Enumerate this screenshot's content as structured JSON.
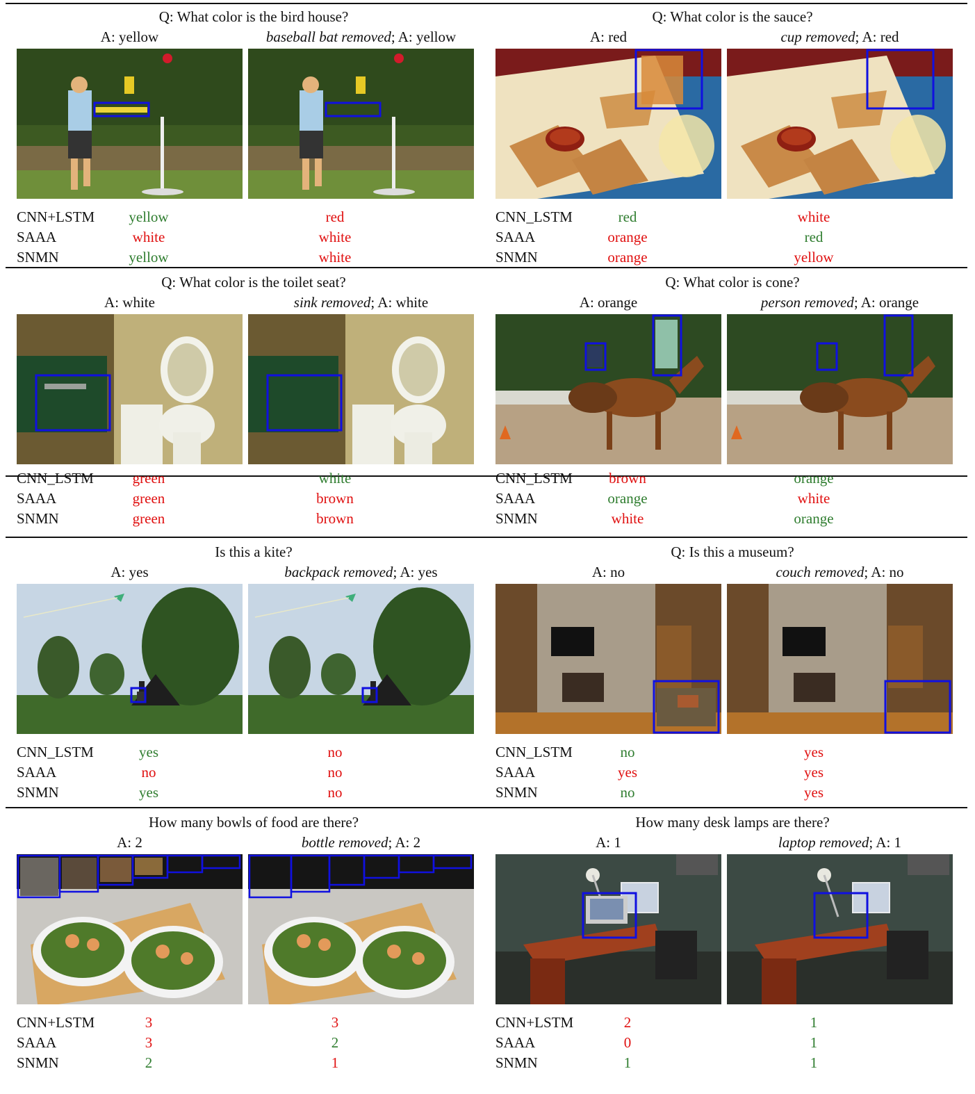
{
  "colors": {
    "correct": "#2f7d2f",
    "wrong": "#e01010",
    "box": "#1010e0"
  },
  "rows": [
    {
      "panels": [
        {
          "question": "Q: What color is the bird house?",
          "answer_orig": "A: yellow",
          "removed_object": "baseball bat removed",
          "answer_edit": "; A: yellow",
          "image_orig_icon": "photo-boy-batting",
          "image_edit_icon": "photo-boy-batting-bat-removed",
          "results": [
            {
              "model": "CNN+LSTM",
              "orig": "yellow",
              "orig_status": "correct",
              "edit": "red",
              "edit_status": "wrong"
            },
            {
              "model": "SAAA",
              "orig": "white",
              "orig_status": "wrong",
              "edit": "white",
              "edit_status": "wrong"
            },
            {
              "model": "SNMN",
              "orig": "yellow",
              "orig_status": "correct",
              "edit": "white",
              "edit_status": "wrong"
            }
          ]
        },
        {
          "question": "Q: What color is the sauce?",
          "answer_orig": "A: red",
          "removed_object": "cup removed",
          "answer_edit": "; A: red",
          "image_orig_icon": "photo-samosas",
          "image_edit_icon": "photo-samosas-cup-removed",
          "results": [
            {
              "model": "CNN_LSTM",
              "orig": "red",
              "orig_status": "correct",
              "edit": "white",
              "edit_status": "wrong"
            },
            {
              "model": "SAAA",
              "orig": "orange",
              "orig_status": "wrong",
              "edit": "red",
              "edit_status": "correct"
            },
            {
              "model": "SNMN",
              "orig": "orange",
              "orig_status": "wrong",
              "edit": "yellow",
              "edit_status": "wrong"
            }
          ]
        }
      ]
    },
    {
      "panels": [
        {
          "question": "Q: What color is the toilet seat?",
          "answer_orig": "A: white",
          "removed_object": "sink removed",
          "answer_edit": "; A: white",
          "image_orig_icon": "photo-bathroom",
          "image_edit_icon": "photo-bathroom-sink-removed",
          "results": [
            {
              "model": "CNN_LSTM",
              "orig": "green",
              "orig_status": "wrong",
              "edit": "white",
              "edit_status": "correct"
            },
            {
              "model": "SAAA",
              "orig": "green",
              "orig_status": "wrong",
              "edit": "brown",
              "edit_status": "wrong"
            },
            {
              "model": "SNMN",
              "orig": "green",
              "orig_status": "wrong",
              "edit": "brown",
              "edit_status": "wrong"
            }
          ]
        },
        {
          "question": "Q: What color is cone?",
          "answer_orig": "A: orange",
          "removed_object": "person removed",
          "answer_edit": "; A: orange",
          "image_orig_icon": "photo-horse-riders",
          "image_edit_icon": "photo-horse-riders-person-removed",
          "results": [
            {
              "model": "CNN_LSTM",
              "orig": "brown",
              "orig_status": "wrong",
              "edit": "orange",
              "edit_status": "correct"
            },
            {
              "model": "SAAA",
              "orig": "orange",
              "orig_status": "correct",
              "edit": "white",
              "edit_status": "wrong"
            },
            {
              "model": "SNMN",
              "orig": "white",
              "orig_status": "wrong",
              "edit": "orange",
              "edit_status": "correct"
            }
          ]
        }
      ]
    },
    {
      "panels": [
        {
          "question": "Is this a kite?",
          "answer_orig": "A: yes",
          "removed_object": "backpack removed",
          "answer_edit": "; A: yes",
          "image_orig_icon": "photo-kite-field",
          "image_edit_icon": "photo-kite-field-backpack-removed",
          "results": [
            {
              "model": "CNN_LSTM",
              "orig": "yes",
              "orig_status": "correct",
              "edit": "no",
              "edit_status": "wrong"
            },
            {
              "model": "SAAA",
              "orig": "no",
              "orig_status": "wrong",
              "edit": "no",
              "edit_status": "wrong"
            },
            {
              "model": "SNMN",
              "orig": "yes",
              "orig_status": "correct",
              "edit": "no",
              "edit_status": "wrong"
            }
          ]
        },
        {
          "question": "Q: Is this a museum?",
          "answer_orig": "A: no",
          "removed_object": "couch removed",
          "answer_edit": "; A: no",
          "image_orig_icon": "photo-stone-fireplace",
          "image_edit_icon": "photo-stone-fireplace-couch-removed",
          "results": [
            {
              "model": "CNN_LSTM",
              "orig": "no",
              "orig_status": "correct",
              "edit": "yes",
              "edit_status": "wrong"
            },
            {
              "model": "SAAA",
              "orig": "yes",
              "orig_status": "wrong",
              "edit": "yes",
              "edit_status": "wrong"
            },
            {
              "model": "SNMN",
              "orig": "no",
              "orig_status": "correct",
              "edit": "yes",
              "edit_status": "wrong"
            }
          ]
        }
      ]
    },
    {
      "panels": [
        {
          "question": "How many bowls of food are there?",
          "answer_orig": "A: 2",
          "removed_object": "bottle removed",
          "answer_edit": "; A: 2",
          "image_orig_icon": "photo-food-bowls",
          "image_edit_icon": "photo-food-bowls-bottle-removed",
          "results": [
            {
              "model": "CNN+LSTM",
              "orig": "3",
              "orig_status": "wrong",
              "edit": "3",
              "edit_status": "wrong"
            },
            {
              "model": "SAAA",
              "orig": "3",
              "orig_status": "wrong",
              "edit": "2",
              "edit_status": "correct"
            },
            {
              "model": "SNMN",
              "orig": "2",
              "orig_status": "correct",
              "edit": "1",
              "edit_status": "wrong"
            }
          ]
        },
        {
          "question": "How many desk lamps are there?",
          "answer_orig": "A: 1",
          "removed_object": "laptop removed",
          "answer_edit": "; A: 1",
          "image_orig_icon": "photo-office-desk",
          "image_edit_icon": "photo-office-desk-laptop-removed",
          "results": [
            {
              "model": "CNN+LSTM",
              "orig": "2",
              "orig_status": "wrong",
              "edit": "1",
              "edit_status": "correct"
            },
            {
              "model": "SAAA",
              "orig": "0",
              "orig_status": "wrong",
              "edit": "1",
              "edit_status": "correct"
            },
            {
              "model": "SNMN",
              "orig": "1",
              "orig_status": "correct",
              "edit": "1",
              "edit_status": "correct"
            }
          ]
        }
      ]
    }
  ]
}
